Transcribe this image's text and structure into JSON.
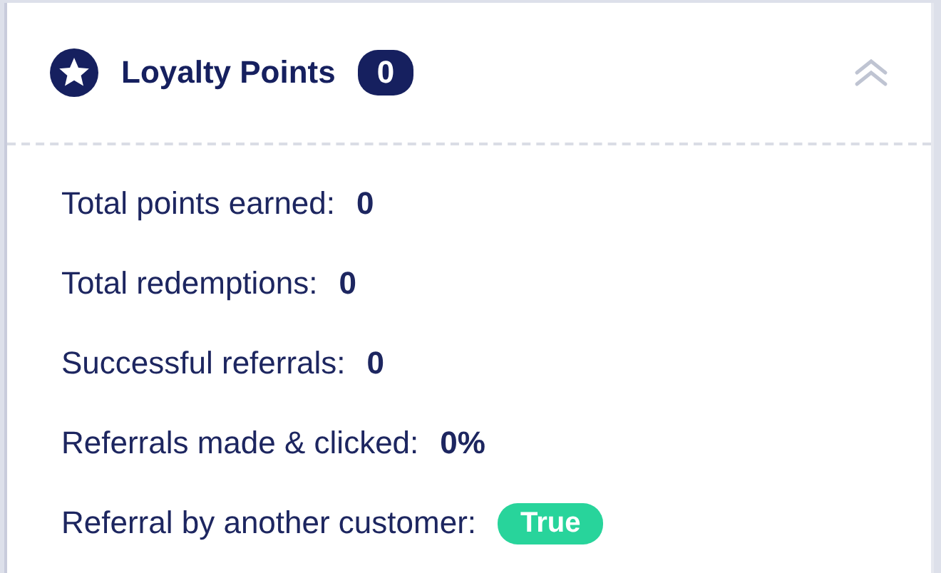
{
  "panel": {
    "title": "Loyalty Points",
    "count": "0",
    "expanded": true
  },
  "stats": [
    {
      "label": "Total points earned:",
      "value": "0",
      "kind": "text"
    },
    {
      "label": "Total redemptions:",
      "value": "0",
      "kind": "text"
    },
    {
      "label": "Successful referrals:",
      "value": "0",
      "kind": "text"
    },
    {
      "label": "Referrals made & clicked:",
      "value": "0%",
      "kind": "text"
    },
    {
      "label": "Referral by another customer:",
      "value": "True",
      "kind": "badge"
    }
  ]
}
